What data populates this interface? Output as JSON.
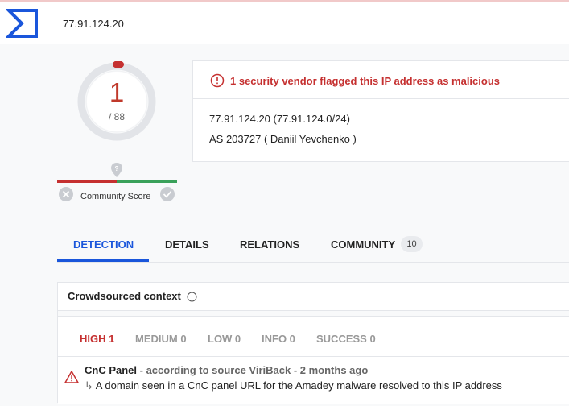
{
  "header": {
    "search_value": "77.91.124.20",
    "logo_icon": "virustotal-sigma-logo"
  },
  "score": {
    "detections": "1",
    "total": "/ 88",
    "accent": "#c53030"
  },
  "community": {
    "label": "Community Score"
  },
  "summary": {
    "alert": "1 security vendor flagged this IP address as malicious",
    "ip_line": "77.91.124.20  (77.91.124.0/24)",
    "as_line": "AS 203727  ( Daniil Yevchenko )"
  },
  "tabs": [
    {
      "label": "DETECTION",
      "active": true
    },
    {
      "label": "DETAILS"
    },
    {
      "label": "RELATIONS"
    },
    {
      "label": "COMMUNITY",
      "badge": "10"
    }
  ],
  "crowdsourced": {
    "title": "Crowdsourced context",
    "severity_tabs": [
      "HIGH 1",
      "MEDIUM 0",
      "LOW 0",
      "INFO 0",
      "SUCCESS 0"
    ],
    "rule": {
      "name": "CnC Panel",
      "source": " - according to source ViriBack - 2 months ago",
      "arrow": "↳",
      "description": " A domain seen in a CnC panel URL for the Amadey malware resolved to this IP address"
    }
  }
}
